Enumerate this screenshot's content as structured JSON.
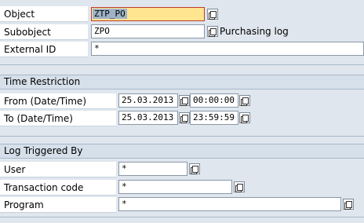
{
  "header": {
    "object": {
      "label": "Object",
      "value": "ZTP_PO"
    },
    "subobject": {
      "label": "Subobject",
      "value": "ZPO",
      "description": "Purchasing log"
    },
    "external_id": {
      "label": "External ID",
      "value": "*"
    }
  },
  "time_restriction": {
    "title": "Time Restriction",
    "from": {
      "label": "From (Date/Time)",
      "date": "25.03.2013",
      "time": "00:00:00"
    },
    "to": {
      "label": "To (Date/Time)",
      "date": "25.03.2013",
      "time": "23:59:59"
    }
  },
  "log_triggered_by": {
    "title": "Log Triggered By",
    "user": {
      "label": "User",
      "value": "*"
    },
    "transaction_code": {
      "label": "Transaction code",
      "value": "*"
    },
    "program": {
      "label": "Program",
      "value": "*"
    }
  },
  "colors": {
    "background": "#dfe6ee",
    "required_field": "#ffe58f",
    "group_header": "#d6e0ea"
  },
  "icons": {
    "match_code": "value-help-icon"
  }
}
